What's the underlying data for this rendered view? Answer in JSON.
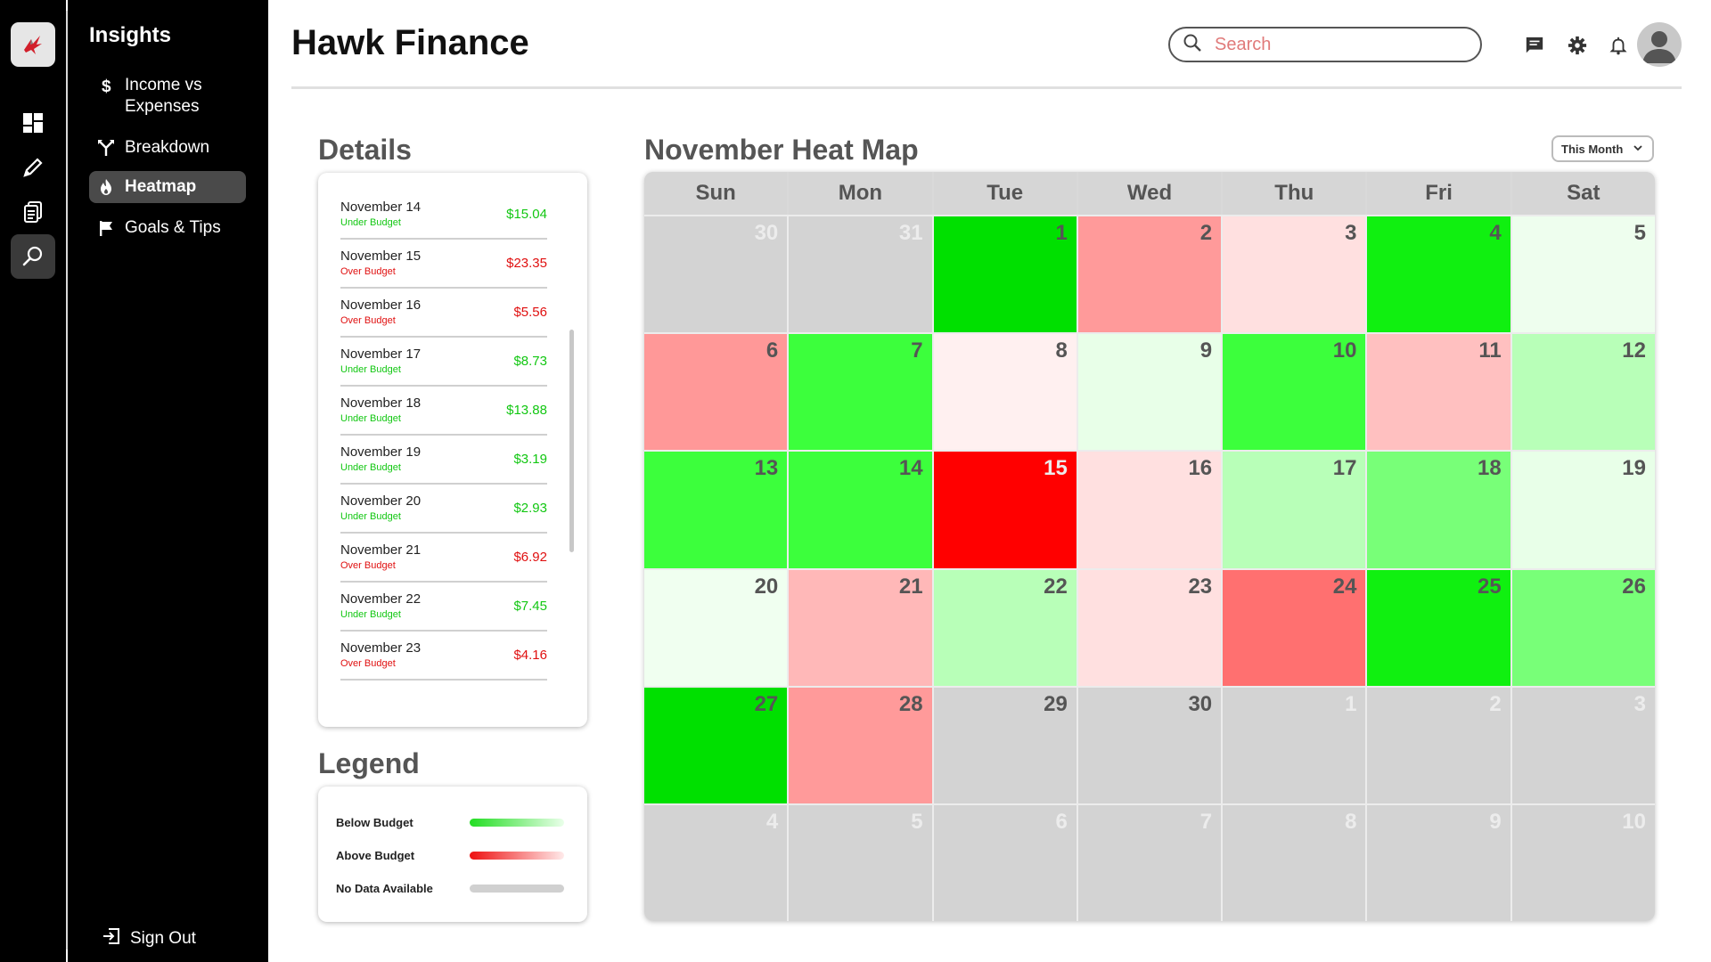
{
  "app": {
    "title": "Hawk Finance"
  },
  "search": {
    "placeholder": "Search"
  },
  "rail": {
    "items": [
      "logo-icon",
      "dashboard-icon",
      "pencil-icon",
      "documents-icon",
      "insights-icon"
    ],
    "active": "insights-icon"
  },
  "sidebar": {
    "title": "Insights",
    "items": [
      {
        "label": "Income vs Expenses",
        "icon": "dollar-icon"
      },
      {
        "label": "Breakdown",
        "icon": "split-icon"
      },
      {
        "label": "Heatmap",
        "icon": "flame-icon",
        "active": true
      },
      {
        "label": "Goals & Tips",
        "icon": "flag-icon"
      }
    ],
    "sign_out": "Sign Out"
  },
  "details": {
    "title": "Details",
    "rows": [
      {
        "date": "November 14",
        "status": "Under Budget",
        "amount": "$15.04"
      },
      {
        "date": "November 15",
        "status": "Over Budget",
        "amount": "$23.35"
      },
      {
        "date": "November 16",
        "status": "Over Budget",
        "amount": "$5.56"
      },
      {
        "date": "November 17",
        "status": "Under Budget",
        "amount": "$8.73"
      },
      {
        "date": "November 18",
        "status": "Under Budget",
        "amount": "$13.88"
      },
      {
        "date": "November 19",
        "status": "Under Budget",
        "amount": "$3.19"
      },
      {
        "date": "November 20",
        "status": "Under Budget",
        "amount": "$2.93"
      },
      {
        "date": "November 21",
        "status": "Over Budget",
        "amount": "$6.92"
      },
      {
        "date": "November 22",
        "status": "Under Budget",
        "amount": "$7.45"
      },
      {
        "date": "November 23",
        "status": "Over Budget",
        "amount": "$4.16"
      }
    ]
  },
  "legend": {
    "title": "Legend",
    "items": [
      {
        "label": "Below Budget",
        "from": "#22dd22",
        "to": "#eaffea"
      },
      {
        "label": "Above Budget",
        "from": "#ee1111",
        "to": "#ffeaea"
      },
      {
        "label": "No Data Available",
        "from": "#d0d0d0",
        "to": "#d0d0d0"
      }
    ]
  },
  "heatmap": {
    "title": "November Heat Map",
    "range_select": "This Month",
    "weekdays": [
      "Sun",
      "Mon",
      "Tue",
      "Wed",
      "Thu",
      "Fri",
      "Sat"
    ],
    "cells": [
      {
        "day": "30",
        "color": "#d3d3d3",
        "faded": true
      },
      {
        "day": "31",
        "color": "#d3d3d3",
        "faded": true
      },
      {
        "day": "1",
        "color": "#00e000"
      },
      {
        "day": "2",
        "color": "#ff9a9a"
      },
      {
        "day": "3",
        "color": "#ffe0e0"
      },
      {
        "day": "4",
        "color": "#10f010"
      },
      {
        "day": "5",
        "color": "#eefeee"
      },
      {
        "day": "6",
        "color": "#ff9898"
      },
      {
        "day": "7",
        "color": "#3cff3c"
      },
      {
        "day": "8",
        "color": "#fff0f0"
      },
      {
        "day": "9",
        "color": "#e8ffe8"
      },
      {
        "day": "10",
        "color": "#3cff3c"
      },
      {
        "day": "11",
        "color": "#ffc0c0"
      },
      {
        "day": "12",
        "color": "#b8ffb8"
      },
      {
        "day": "13",
        "color": "#3cff3c"
      },
      {
        "day": "14",
        "color": "#3cff3c"
      },
      {
        "day": "15",
        "color": "#ff0000",
        "faded": true
      },
      {
        "day": "16",
        "color": "#ffe0e0"
      },
      {
        "day": "17",
        "color": "#b8ffb8"
      },
      {
        "day": "18",
        "color": "#78ff78"
      },
      {
        "day": "19",
        "color": "#e8ffe8"
      },
      {
        "day": "20",
        "color": "#f0fff0"
      },
      {
        "day": "21",
        "color": "#ffb8b8"
      },
      {
        "day": "22",
        "color": "#b8ffb8"
      },
      {
        "day": "23",
        "color": "#ffe0e0"
      },
      {
        "day": "24",
        "color": "#ff7070"
      },
      {
        "day": "25",
        "color": "#10f010"
      },
      {
        "day": "26",
        "color": "#78ff78"
      },
      {
        "day": "27",
        "color": "#00e000"
      },
      {
        "day": "28",
        "color": "#ff9a9a"
      },
      {
        "day": "29",
        "color": "#d3d3d3"
      },
      {
        "day": "30",
        "color": "#d3d3d3"
      },
      {
        "day": "1",
        "color": "#d3d3d3",
        "faded": true
      },
      {
        "day": "2",
        "color": "#d3d3d3",
        "faded": true
      },
      {
        "day": "3",
        "color": "#d3d3d3",
        "faded": true
      },
      {
        "day": "4",
        "color": "#d3d3d3",
        "faded": true
      },
      {
        "day": "5",
        "color": "#d3d3d3",
        "faded": true
      },
      {
        "day": "6",
        "color": "#d3d3d3",
        "faded": true
      },
      {
        "day": "7",
        "color": "#d3d3d3",
        "faded": true
      },
      {
        "day": "8",
        "color": "#d3d3d3",
        "faded": true
      },
      {
        "day": "9",
        "color": "#d3d3d3",
        "faded": true
      },
      {
        "day": "10",
        "color": "#d3d3d3",
        "faded": true
      }
    ]
  },
  "colors": {
    "under": "#12c712",
    "over": "#e01010",
    "no_data": "#d3d3d3"
  }
}
